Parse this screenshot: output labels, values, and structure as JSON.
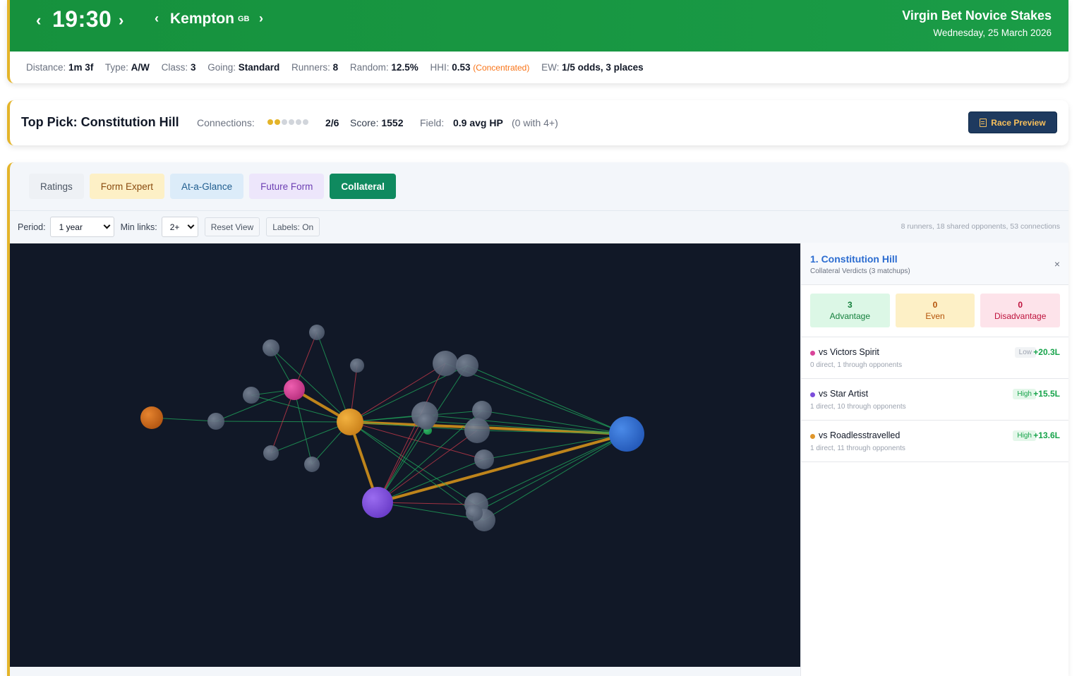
{
  "header": {
    "time": "19:30",
    "course": "Kempton",
    "country": "GB",
    "race_name": "Virgin Bet Novice Stakes",
    "date": "Wednesday, 25 March 2026",
    "meta": {
      "distance_label": "Distance:",
      "distance": "1m 3f",
      "type_label": "Type:",
      "type": "A/W",
      "class_label": "Class:",
      "class": "3",
      "going_label": "Going:",
      "going": "Standard",
      "runners_label": "Runners:",
      "runners": "8",
      "random_label": "Random:",
      "random": "12.5%",
      "hhi_label": "HHI:",
      "hhi": "0.53",
      "hhi_note": "(Concentrated)",
      "ew_label": "EW:",
      "ew": "1/5 odds, 3 places"
    }
  },
  "top_pick": {
    "title": "Top Pick: Constitution Hill",
    "connections_label": "Connections:",
    "connections_filled": 2,
    "connections_total": 6,
    "connections_value": "2/6",
    "score_label": "Score:",
    "score": "1552",
    "field_label": "Field:",
    "field_value": "0.9 avg HP",
    "field_note": "(0 with 4+)",
    "preview_button": "Race Preview",
    "colors": {
      "dot_on": "#e4b429",
      "dot_off": "#d1d5db",
      "button_bg": "#1e3a5f"
    }
  },
  "tabs": [
    {
      "label": "Ratings"
    },
    {
      "label": "Form Expert"
    },
    {
      "label": "At-a-Glance"
    },
    {
      "label": "Future Form"
    },
    {
      "label": "Collateral",
      "active": true
    }
  ],
  "toolbar": {
    "period_label": "Period:",
    "period_value": "1 year",
    "min_links_label": "Min links:",
    "min_links_value": "2+",
    "reset_label": "Reset View",
    "labels_toggle": "Labels: On",
    "stats": "8 runners, 18 shared opponents, 53 connections"
  },
  "graph": {
    "background": "#111827",
    "edge_colors": {
      "advantage": "#1fa35a",
      "disadvantage": "#c53a4a",
      "selected": "#c88a1a"
    },
    "runner_colors": [
      "#e0962a",
      "#7c4ddb",
      "#2f6fd4",
      "#d9449a",
      "#d06a1e",
      "#1e9e55"
    ],
    "opponent_color": "#5a6678"
  },
  "side_panel": {
    "title": "1. Constitution Hill",
    "subtitle": "Collateral Verdicts (3 matchups)",
    "close": "×",
    "verdicts": {
      "advantage_count": "3",
      "advantage_label": "Advantage",
      "even_count": "0",
      "even_label": "Even",
      "disadvantage_count": "0",
      "disadvantage_label": "Disadvantage"
    },
    "matchups": [
      {
        "name": "vs Victors Spirit",
        "detail": "0 direct, 1 through opponents",
        "confidence": "Low",
        "margin": "+20.3L",
        "color": "#d9449a"
      },
      {
        "name": "vs Star Artist",
        "detail": "1 direct, 10 through opponents",
        "confidence": "High",
        "margin": "+15.5L",
        "color": "#7c4ddb"
      },
      {
        "name": "vs Roadlesstravelled",
        "detail": "1 direct, 11 through opponents",
        "confidence": "High",
        "margin": "+13.6L",
        "color": "#e0962a"
      }
    ]
  }
}
